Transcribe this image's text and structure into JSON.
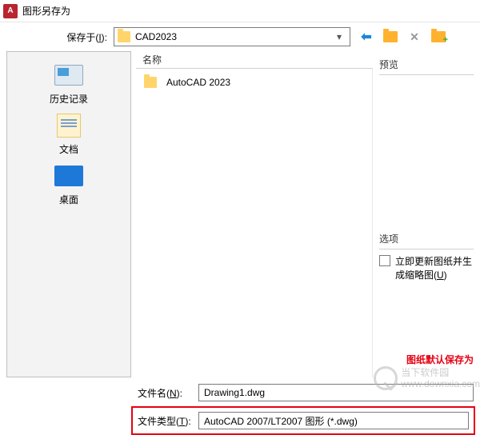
{
  "title": "图形另存为",
  "appIconLetter": "A",
  "saveInLabelPrefix": "保存于(",
  "saveInLabelKey": "I",
  "saveInLabelSuffix": "):",
  "currentFolder": "CAD2023",
  "fileListHeader": "名称",
  "files": [
    {
      "name": "AutoCAD 2023"
    }
  ],
  "sidebar": {
    "history": "历史记录",
    "documents": "文档",
    "desktop": "桌面"
  },
  "rightPanel": {
    "previewLabel": "预览",
    "optionsLabel": "选项",
    "updateThumbPrefix": "立即更新图纸并生成缩略图(",
    "updateThumbKey": "U",
    "updateThumbSuffix": ")",
    "redNote": "图纸默认保存为"
  },
  "fileName": {
    "labelPrefix": "文件名(",
    "labelKey": "N",
    "labelSuffix": "):",
    "value": "Drawing1.dwg"
  },
  "fileType": {
    "labelPrefix": "文件类型(",
    "labelKey": "T",
    "labelSuffix": "):",
    "value": "AutoCAD 2007/LT2007 图形 (*.dwg)"
  },
  "watermark": {
    "line1": "当下软件园",
    "line2": "www.downxia.com"
  }
}
